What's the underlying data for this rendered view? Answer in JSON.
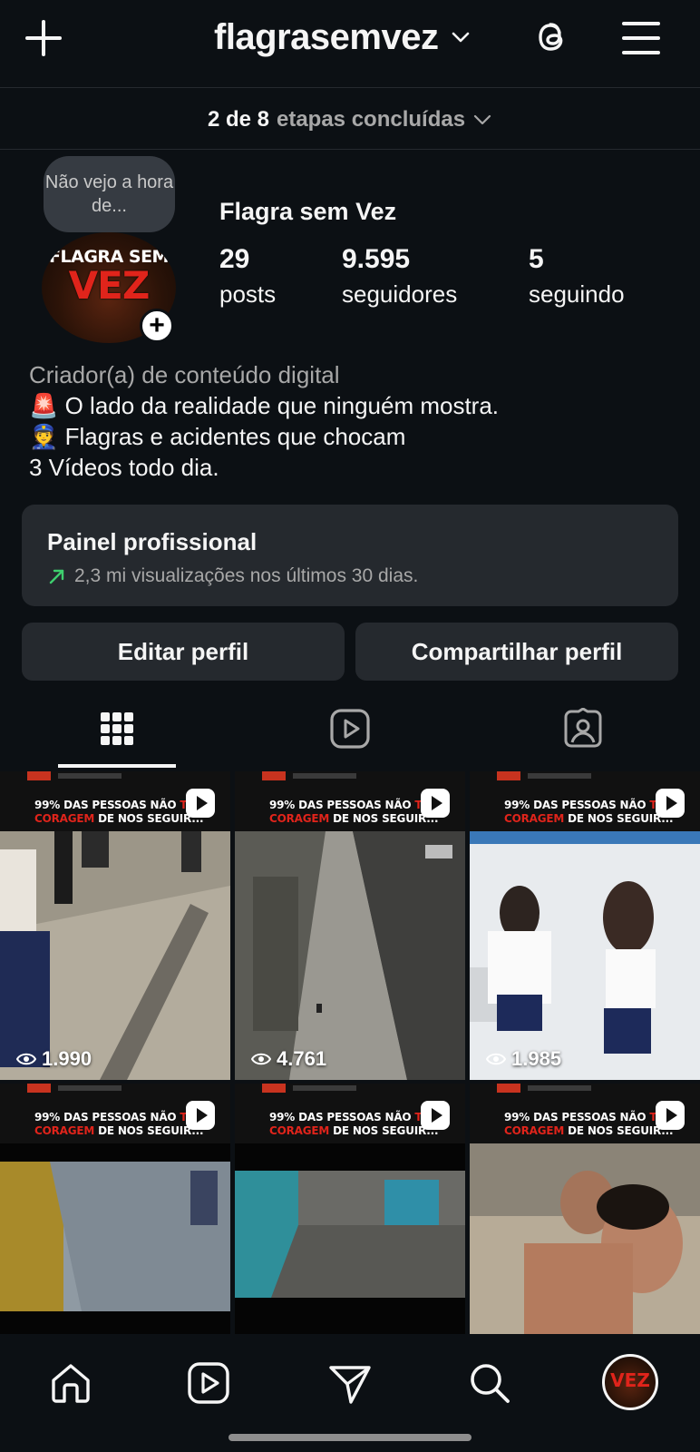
{
  "header": {
    "username": "flagrasemvez",
    "icons": [
      "plus-icon",
      "chevron-down-icon",
      "threads-icon",
      "menu-icon"
    ]
  },
  "steps": {
    "progress": "2 de 8",
    "label": "etapas concluídas"
  },
  "profile": {
    "note": "Não vejo a hora de...",
    "avatar_text_top": "FLAGRA SEM",
    "avatar_text_bottom": "VEZ",
    "display_name": "Flagra sem Vez",
    "stats": [
      {
        "value": "29",
        "label": "posts"
      },
      {
        "value": "9.595",
        "label": "seguidores"
      },
      {
        "value": "5",
        "label": "seguindo"
      }
    ],
    "category": "Criador(a) de conteúdo digital",
    "bio_lines": [
      {
        "emoji": "🚨",
        "text": "O lado da realidade que ninguém mostra."
      },
      {
        "emoji": "👮",
        "text": "Flagras e acidentes que chocam"
      },
      {
        "emoji": "",
        "text": "3 Vídeos todo dia."
      }
    ]
  },
  "panel": {
    "title": "Painel profissional",
    "subtitle": "2,3 mi visualizações nos últimos 30 dias.",
    "trend_color": "#3ecf6e"
  },
  "buttons": {
    "edit": "Editar perfil",
    "share": "Compartilhar perfil"
  },
  "tabs": [
    "grid-icon",
    "reels-icon",
    "tagged-icon"
  ],
  "posts": [
    {
      "headline_white": "99% DAS PESSOAS NÃO ",
      "headline_red_a": "TE",
      "headline_red_b": "CORAGEM",
      "headline_tail": " DE NOS SEGUIR...",
      "views": "1.990"
    },
    {
      "headline_white": "99% DAS PESSOAS NÃO ",
      "headline_red_a": "TE",
      "headline_red_b": "CORAGEM",
      "headline_tail": " DE NOS SEGUIR...",
      "views": "4.761"
    },
    {
      "headline_white": "99% DAS PESSOAS NÃO ",
      "headline_red_a": "TE",
      "headline_red_b": "CORAGEM",
      "headline_tail": " DE NOS SEGUIR...",
      "views": "1.985"
    },
    {
      "headline_white": "99% DAS PESSOAS NÃO ",
      "headline_red_a": "TE",
      "headline_red_b": "CORAGEM",
      "headline_tail": " DE NOS SEGUIR...",
      "views": ""
    },
    {
      "headline_white": "99% DAS PESSOAS NÃO ",
      "headline_red_a": "TE",
      "headline_red_b": "CORAGEM",
      "headline_tail": " DE NOS SEGUIR...",
      "views": ""
    },
    {
      "headline_white": "99% DAS PESSOAS NÃO ",
      "headline_red_a": "TE",
      "headline_red_b": "CORAGEM",
      "headline_tail": " DE NOS SEGUIR...",
      "views": ""
    }
  ],
  "bottom_nav": [
    "home-icon",
    "reels-icon",
    "direct-icon",
    "search-icon",
    "profile-avatar"
  ],
  "colors": {
    "background": "#0c1014",
    "card": "#25292e",
    "muted_text": "#a8a8a8",
    "brand_red": "#e0241b"
  }
}
